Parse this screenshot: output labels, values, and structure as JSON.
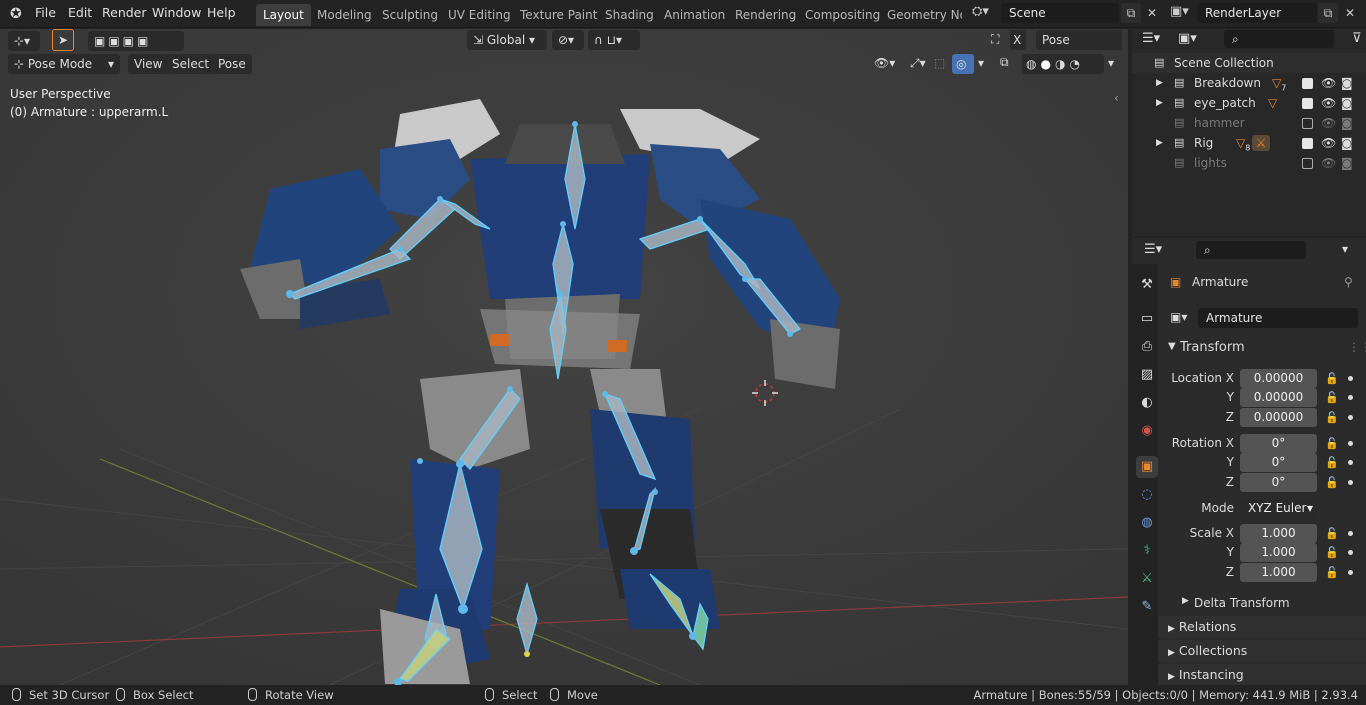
{
  "menus": [
    "File",
    "Edit",
    "Render",
    "Window",
    "Help"
  ],
  "workspaces": [
    "Layout",
    "Modeling",
    "Sculpting",
    "UV Editing",
    "Texture Paint",
    "Shading",
    "Animation",
    "Rendering",
    "Compositing",
    "Geometry Nod"
  ],
  "scene": "Scene",
  "render_layer": "RenderLayer",
  "viewport": {
    "orientation": "Global",
    "pose_options": "Pose Options",
    "mode": "Pose Mode",
    "view_menus": [
      "View",
      "Select",
      "Pose"
    ],
    "perspective": "User Perspective",
    "active": "(0) Armature : upperarm.L"
  },
  "outliner": {
    "root": "Scene Collection",
    "items": [
      {
        "name": "Breakdown",
        "count": "7",
        "visible": true
      },
      {
        "name": "eye_patch",
        "count": "",
        "visible": true
      },
      {
        "name": "hammer",
        "count": "",
        "visible": false
      },
      {
        "name": "Rig",
        "count": "8",
        "visible": true
      },
      {
        "name": "lights",
        "count": "",
        "visible": false
      }
    ]
  },
  "properties": {
    "object_name": "Armature",
    "data_name": "Armature",
    "transform_title": "Transform",
    "location_label": "Location X",
    "location": [
      "0.00000",
      "0.00000",
      "0.00000"
    ],
    "rotation_label": "Rotation X",
    "rotation": [
      "0°",
      "0°",
      "0°"
    ],
    "mode_label": "Mode",
    "mode": "XYZ Euler",
    "scale_label": "Scale X",
    "scale": [
      "1.000",
      "1.000",
      "1.000"
    ],
    "axis_y": "Y",
    "axis_z": "Z",
    "delta": "Delta Transform",
    "sections": [
      "Relations",
      "Collections",
      "Instancing"
    ]
  },
  "status": {
    "items": [
      "Set 3D Cursor",
      "Box Select",
      "Rotate View",
      "Select",
      "Move"
    ],
    "info": "Armature | Bones:55/59 | Objects:0/0 | Memory: 441.9 MiB | 2.93.4"
  },
  "colors": {
    "accent": "#4772b3",
    "bone": "#5fb8e8",
    "orange": "#e8872e",
    "robot_blue": "#1f3f76"
  }
}
